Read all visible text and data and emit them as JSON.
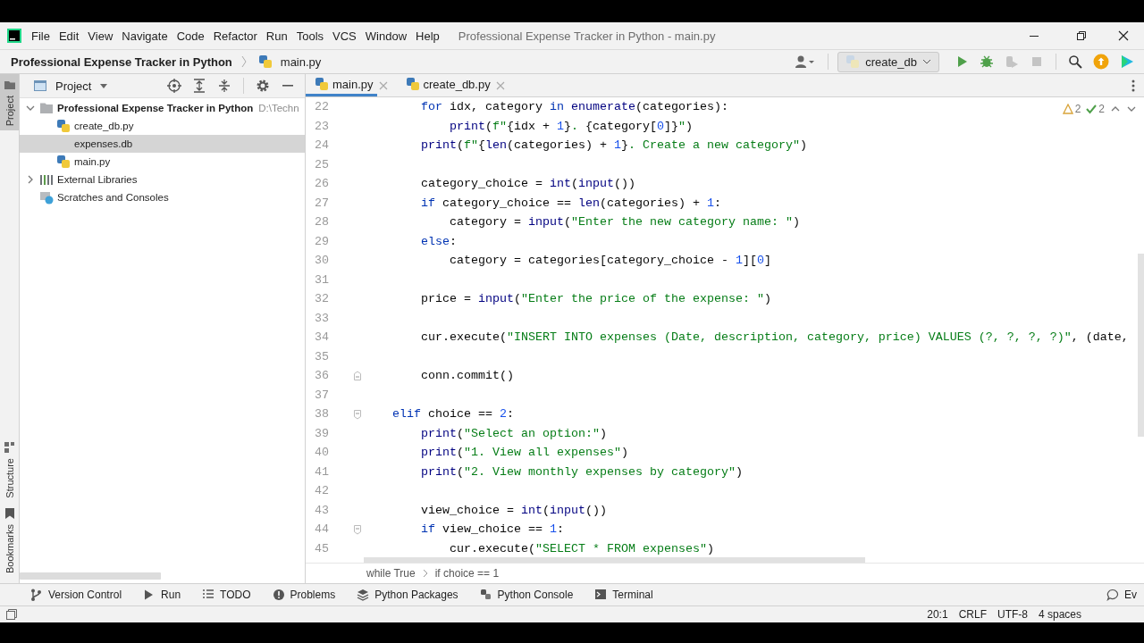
{
  "title_bar": {
    "menu": [
      "File",
      "Edit",
      "View",
      "Navigate",
      "Code",
      "Refactor",
      "Run",
      "Tools",
      "VCS",
      "Window",
      "Help"
    ],
    "window_title": "Professional Expense Tracker in Python - main.py"
  },
  "nav_bar": {
    "project": "Professional Expense Tracker in Python",
    "file": "main.py",
    "run_config": "create_db",
    "actions": [
      {
        "kind": "run",
        "disabled": false
      },
      {
        "kind": "debug",
        "disabled": false
      },
      {
        "kind": "coverage",
        "disabled": true
      },
      {
        "kind": "stop",
        "disabled": true
      }
    ]
  },
  "side_stripe": [
    {
      "label": "Project",
      "kind": "folder",
      "selected": true
    },
    {
      "label": "Structure",
      "kind": "structure",
      "selected": false
    },
    {
      "label": "Bookmarks",
      "kind": "bookmark",
      "selected": false
    }
  ],
  "project_panel": {
    "title": "Project",
    "tree": [
      {
        "label": "Professional Expense Tracker in Python",
        "path": "D:\\Techn",
        "kind": "folder",
        "expanded": true,
        "selected": false,
        "children": [
          {
            "label": "create_db.py",
            "kind": "python",
            "selected": false
          },
          {
            "label": "expenses.db",
            "kind": "db",
            "selected": true
          },
          {
            "label": "main.py",
            "kind": "python",
            "selected": false
          }
        ]
      },
      {
        "label": "External Libraries",
        "kind": "library",
        "expanded": false,
        "selected": false
      },
      {
        "label": "Scratches and Consoles",
        "kind": "scratches",
        "selected": false
      }
    ]
  },
  "editor": {
    "tabs": [
      {
        "label": "main.py",
        "selected": true
      },
      {
        "label": "create_db.py",
        "selected": false
      }
    ],
    "inspections": [
      {
        "kind": "warning",
        "count": "2"
      },
      {
        "kind": "ok",
        "count": "2"
      }
    ],
    "lines": [
      {
        "number": "22",
        "tokens": [
          {
            "kind": "keyword",
            "text": "        for"
          },
          {
            "kind": "plain",
            "text": " idx, category "
          },
          {
            "kind": "keyword",
            "text": "in"
          },
          {
            "kind": "builtin",
            "text": " enumerate"
          },
          {
            "kind": "plain",
            "text": "(categories):"
          }
        ]
      },
      {
        "number": "23",
        "tokens": [
          {
            "kind": "builtin",
            "text": "            print"
          },
          {
            "kind": "plain",
            "text": "("
          },
          {
            "kind": "string",
            "text": "f\""
          },
          {
            "kind": "plain",
            "text": "{idx + "
          },
          {
            "kind": "number",
            "text": "1"
          },
          {
            "kind": "plain",
            "text": "}"
          },
          {
            "kind": "string",
            "text": ". "
          },
          {
            "kind": "plain",
            "text": "{category["
          },
          {
            "kind": "number",
            "text": "0"
          },
          {
            "kind": "plain",
            "text": "]}"
          },
          {
            "kind": "string",
            "text": "\""
          },
          {
            "kind": "plain",
            "text": ")"
          }
        ]
      },
      {
        "number": "24",
        "tokens": [
          {
            "kind": "builtin",
            "text": "        print"
          },
          {
            "kind": "plain",
            "text": "("
          },
          {
            "kind": "string",
            "text": "f\""
          },
          {
            "kind": "plain",
            "text": "{"
          },
          {
            "kind": "builtin",
            "text": "len"
          },
          {
            "kind": "plain",
            "text": "(categories) + "
          },
          {
            "kind": "number",
            "text": "1"
          },
          {
            "kind": "plain",
            "text": "}"
          },
          {
            "kind": "string",
            "text": ". Create a new category\""
          },
          {
            "kind": "plain",
            "text": ")"
          }
        ]
      },
      {
        "number": "25"
      },
      {
        "number": "26",
        "tokens": [
          {
            "kind": "plain",
            "text": "        category_choice = "
          },
          {
            "kind": "builtin",
            "text": "int"
          },
          {
            "kind": "plain",
            "text": "("
          },
          {
            "kind": "builtin",
            "text": "input"
          },
          {
            "kind": "plain",
            "text": "())"
          }
        ]
      },
      {
        "number": "27",
        "tokens": [
          {
            "kind": "keyword",
            "text": "        if"
          },
          {
            "kind": "plain",
            "text": " category_choice == "
          },
          {
            "kind": "builtin",
            "text": "len"
          },
          {
            "kind": "plain",
            "text": "(categories) + "
          },
          {
            "kind": "number",
            "text": "1"
          },
          {
            "kind": "plain",
            "text": ":"
          }
        ]
      },
      {
        "number": "28",
        "tokens": [
          {
            "kind": "plain",
            "text": "            category = "
          },
          {
            "kind": "builtin",
            "text": "input"
          },
          {
            "kind": "plain",
            "text": "("
          },
          {
            "kind": "string",
            "text": "\"Enter the new category name: \""
          },
          {
            "kind": "plain",
            "text": ")"
          }
        ]
      },
      {
        "number": "29",
        "tokens": [
          {
            "kind": "keyword",
            "text": "        else"
          },
          {
            "kind": "plain",
            "text": ":"
          }
        ]
      },
      {
        "number": "30",
        "tokens": [
          {
            "kind": "plain",
            "text": "            category = categories[category_choice - "
          },
          {
            "kind": "number",
            "text": "1"
          },
          {
            "kind": "plain",
            "text": "]["
          },
          {
            "kind": "number",
            "text": "0"
          },
          {
            "kind": "plain",
            "text": "]"
          }
        ]
      },
      {
        "number": "31"
      },
      {
        "number": "32",
        "tokens": [
          {
            "kind": "plain",
            "text": "        price = "
          },
          {
            "kind": "builtin",
            "text": "input"
          },
          {
            "kind": "plain",
            "text": "("
          },
          {
            "kind": "string",
            "text": "\"Enter the price of the expense: \""
          },
          {
            "kind": "plain",
            "text": ")"
          }
        ]
      },
      {
        "number": "33"
      },
      {
        "number": "34",
        "tokens": [
          {
            "kind": "plain",
            "text": "        cur.execute("
          },
          {
            "kind": "string",
            "text": "\"INSERT INTO expenses (Date, description, category, price) VALUES (?, ?, ?, ?)\""
          },
          {
            "kind": "plain",
            "text": ", (date,"
          }
        ]
      },
      {
        "number": "35"
      },
      {
        "number": "36",
        "kind": "fold_end",
        "tokens": [
          {
            "kind": "plain",
            "text": "        conn.commit()"
          }
        ]
      },
      {
        "number": "37"
      },
      {
        "number": "38",
        "kind": "fold_start",
        "tokens": [
          {
            "kind": "keyword",
            "text": "    elif"
          },
          {
            "kind": "plain",
            "text": " choice == "
          },
          {
            "kind": "number",
            "text": "2"
          },
          {
            "kind": "plain",
            "text": ":"
          }
        ]
      },
      {
        "number": "39",
        "tokens": [
          {
            "kind": "builtin",
            "text": "        print"
          },
          {
            "kind": "plain",
            "text": "("
          },
          {
            "kind": "string",
            "text": "\"Select an option:\""
          },
          {
            "kind": "plain",
            "text": ")"
          }
        ]
      },
      {
        "number": "40",
        "tokens": [
          {
            "kind": "builtin",
            "text": "        print"
          },
          {
            "kind": "plain",
            "text": "("
          },
          {
            "kind": "string",
            "text": "\"1. View all expenses\""
          },
          {
            "kind": "plain",
            "text": ")"
          }
        ]
      },
      {
        "number": "41",
        "tokens": [
          {
            "kind": "builtin",
            "text": "        print"
          },
          {
            "kind": "plain",
            "text": "("
          },
          {
            "kind": "string",
            "text": "\"2. View monthly expenses by category\""
          },
          {
            "kind": "plain",
            "text": ")"
          }
        ]
      },
      {
        "number": "42"
      },
      {
        "number": "43",
        "tokens": [
          {
            "kind": "plain",
            "text": "        view_choice = "
          },
          {
            "kind": "builtin",
            "text": "int"
          },
          {
            "kind": "plain",
            "text": "("
          },
          {
            "kind": "builtin",
            "text": "input"
          },
          {
            "kind": "plain",
            "text": "())"
          }
        ]
      },
      {
        "number": "44",
        "kind": "fold_start",
        "tokens": [
          {
            "kind": "keyword",
            "text": "        if"
          },
          {
            "kind": "plain",
            "text": " view_choice == "
          },
          {
            "kind": "number",
            "text": "1"
          },
          {
            "kind": "plain",
            "text": ":"
          }
        ]
      },
      {
        "number": "45",
        "tokens": [
          {
            "kind": "plain",
            "text": "            cur.execute("
          },
          {
            "kind": "string",
            "text": "\"SELECT * FROM expenses\""
          },
          {
            "kind": "plain",
            "text": ")"
          }
        ]
      }
    ],
    "breadcrumbs": [
      "while True",
      "if choice == 1"
    ]
  },
  "tool_windows": [
    {
      "label": "Version Control",
      "kind": "vcs"
    },
    {
      "label": "Run",
      "kind": "run"
    },
    {
      "label": "TODO",
      "kind": "todo"
    },
    {
      "label": "Problems",
      "kind": "problems"
    },
    {
      "label": "Python Packages",
      "kind": "packages"
    },
    {
      "label": "Python Console",
      "kind": "console"
    },
    {
      "label": "Terminal",
      "kind": "terminal"
    }
  ],
  "tool_windows_right": [
    {
      "label": "Ev",
      "kind": "event"
    }
  ],
  "status_bar": {
    "items": [
      "20:1",
      "CRLF",
      "UTF-8",
      "4 spaces"
    ]
  }
}
